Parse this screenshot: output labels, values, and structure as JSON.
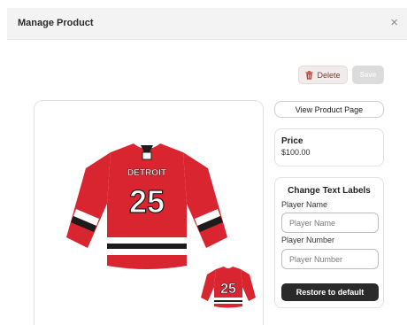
{
  "header": {
    "title": "Manage Product",
    "close_glyph": "×",
    "close_icon": "close-icon"
  },
  "toolbar": {
    "delete_label": "Delete",
    "delete_icon": "trash-icon",
    "save_label": "Save"
  },
  "product": {
    "team_text": "DETROIT",
    "number_text": "25",
    "small_number_text": "25",
    "jersey_colors": {
      "body": "#d9252f",
      "stripe_white": "#ffffff",
      "stripe_black": "#1c1c1c"
    }
  },
  "sidebar": {
    "view_button_label": "View Product Page",
    "price_label": "Price",
    "price_value": "$100.00",
    "labels_heading": "Change Text Labels",
    "player_name_label": "Player Name",
    "player_name_placeholder": "Player Name",
    "player_number_label": "Player Number",
    "player_number_placeholder": "Player Number",
    "restore_label": "Restore to default"
  },
  "colors": {
    "accent_dark": "#2a2a2a",
    "delete_text": "#7a3a30",
    "delete_icon": "#c0392b"
  }
}
